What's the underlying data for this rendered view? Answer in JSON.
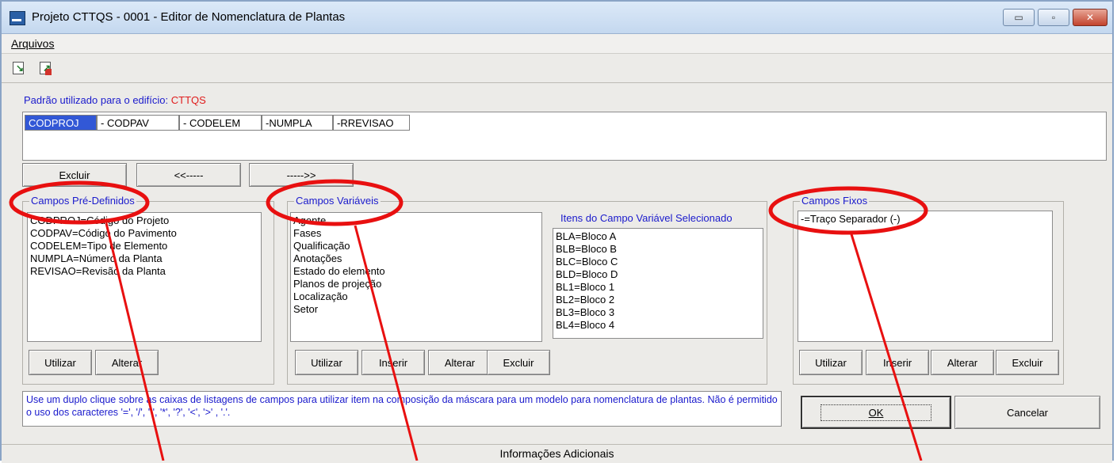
{
  "window": {
    "title": "Projeto CTTQS - 0001 - Editor de Nomenclatura de Plantas",
    "min_glyph": "▭",
    "max_glyph": "▫",
    "close_glyph": "✕"
  },
  "menu": {
    "file": "Arquivos"
  },
  "toolbar": {
    "icons": [
      "import-doc-icon",
      "export-doc-icon"
    ]
  },
  "standard": {
    "label": "Padrão utilizado para o edifício: ",
    "building": "CTTQS"
  },
  "mask_tokens": [
    "CODPROJ",
    "- CODPAV",
    "- CODELEM",
    "-NUMPLA",
    "-RREVISAO"
  ],
  "mask_buttons": {
    "delete": "Excluir",
    "back": "<<-----",
    "forward": "----->>"
  },
  "predefined": {
    "title": "Campos Pré-Definidos",
    "items": [
      "CODPROJ=Código do Projeto",
      "CODPAV=Código do Pavimento",
      "CODELEM=Tipo de Elemento",
      "NUMPLA=Número da Planta",
      "REVISAO=Revisão da Planta"
    ],
    "use": "Utilizar",
    "edit": "Alterar"
  },
  "variable": {
    "title": "Campos Variáveis",
    "items": [
      "Agente",
      "Fases",
      "Qualificação",
      "Anotações",
      "Estado do elemento",
      "Planos de projeção",
      "Localização",
      "Setor"
    ],
    "items_title": "Itens do Campo Variável Selecionado",
    "sub_items": [
      "BLA=Bloco A",
      "BLB=Bloco B",
      "BLC=Bloco C",
      "BLD=Bloco D",
      "BL1=Bloco 1",
      "BL2=Bloco 2",
      "BL3=Bloco 3",
      "BL4=Bloco 4"
    ],
    "use": "Utilizar",
    "insert": "Inserir",
    "edit": "Alterar",
    "delete": "Excluir"
  },
  "fixed": {
    "title": "Campos Fixos",
    "items": [
      "-=Traço Separador (-)"
    ],
    "use": "Utilizar",
    "insert": "Inserir",
    "edit": "Alterar",
    "delete": "Excluir"
  },
  "info_text": "Use um duplo clique sobre as caixas de listagens de campos para utilizar item na composição da máscara para um modelo para nomenclatura de plantas. Não é permitido o uso dos caracteres '=', '/', '\\', '*', '?', '<', '>' , '.'.",
  "ok": "OK",
  "cancel": "Cancelar",
  "additional_info": "Informações Adicionais",
  "colors": {
    "highlight": "#3258d6",
    "label_blue": "#1a1acc",
    "annotation_red": "#e81010"
  }
}
